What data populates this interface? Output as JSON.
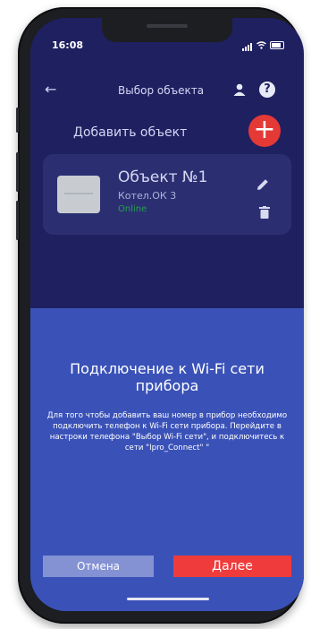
{
  "status_bar": {
    "time": "16:08"
  },
  "header": {
    "back_glyph": "←",
    "title": "Выбор объекта",
    "help_glyph": "?"
  },
  "add_object": {
    "label": "Добавить объект",
    "plus_glyph": "+"
  },
  "object_card": {
    "name": "Объект №1",
    "model": "Котел.ОК 3",
    "status": "Online"
  },
  "dialog": {
    "title": "Подключение к Wi-Fi сети прибора",
    "message": "Для того чтобы добавить ваш номер в прибор необходимо подключить телефон к Wi-Fi сети прибора. Перейдите в настроки телефона \"Выбор Wi-Fi сети\", и подключитесь к сети \"Ipro_Connect\" \"",
    "cancel_label": "Отмена",
    "next_label": "Далее"
  },
  "colors": {
    "background": "#1f2060",
    "card": "#2b2f72",
    "dialog": "#3a52b8",
    "accent_red": "#e53935",
    "online_green": "#24a148"
  },
  "icons": [
    "back-arrow-icon",
    "user-icon",
    "help-icon",
    "plus-icon",
    "pencil-icon",
    "trash-icon",
    "signal-icon",
    "wifi-icon",
    "battery-icon"
  ]
}
